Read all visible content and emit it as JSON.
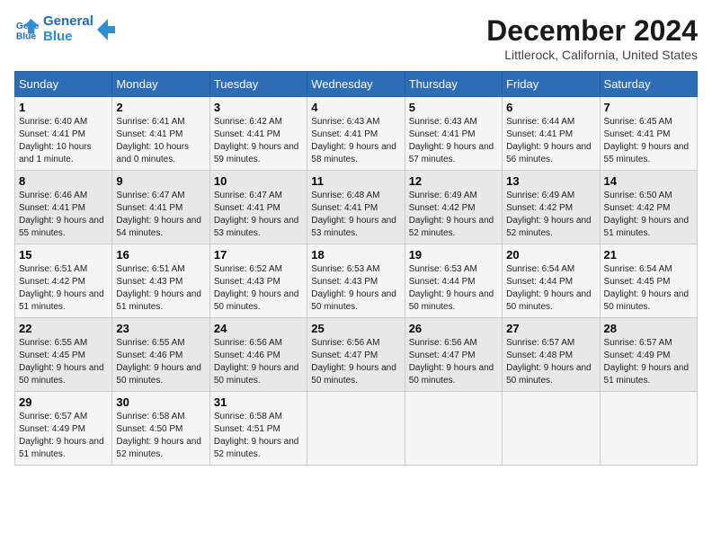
{
  "header": {
    "logo_line1": "General",
    "logo_line2": "Blue",
    "month_title": "December 2024",
    "location": "Littlerock, California, United States"
  },
  "days_of_week": [
    "Sunday",
    "Monday",
    "Tuesday",
    "Wednesday",
    "Thursday",
    "Friday",
    "Saturday"
  ],
  "weeks": [
    [
      {
        "day": "1",
        "sunrise": "6:40 AM",
        "sunset": "4:41 PM",
        "daylight": "10 hours and 1 minute."
      },
      {
        "day": "2",
        "sunrise": "6:41 AM",
        "sunset": "4:41 PM",
        "daylight": "10 hours and 0 minutes."
      },
      {
        "day": "3",
        "sunrise": "6:42 AM",
        "sunset": "4:41 PM",
        "daylight": "9 hours and 59 minutes."
      },
      {
        "day": "4",
        "sunrise": "6:43 AM",
        "sunset": "4:41 PM",
        "daylight": "9 hours and 58 minutes."
      },
      {
        "day": "5",
        "sunrise": "6:43 AM",
        "sunset": "4:41 PM",
        "daylight": "9 hours and 57 minutes."
      },
      {
        "day": "6",
        "sunrise": "6:44 AM",
        "sunset": "4:41 PM",
        "daylight": "9 hours and 56 minutes."
      },
      {
        "day": "7",
        "sunrise": "6:45 AM",
        "sunset": "4:41 PM",
        "daylight": "9 hours and 55 minutes."
      }
    ],
    [
      {
        "day": "8",
        "sunrise": "6:46 AM",
        "sunset": "4:41 PM",
        "daylight": "9 hours and 55 minutes."
      },
      {
        "day": "9",
        "sunrise": "6:47 AM",
        "sunset": "4:41 PM",
        "daylight": "9 hours and 54 minutes."
      },
      {
        "day": "10",
        "sunrise": "6:47 AM",
        "sunset": "4:41 PM",
        "daylight": "9 hours and 53 minutes."
      },
      {
        "day": "11",
        "sunrise": "6:48 AM",
        "sunset": "4:41 PM",
        "daylight": "9 hours and 53 minutes."
      },
      {
        "day": "12",
        "sunrise": "6:49 AM",
        "sunset": "4:42 PM",
        "daylight": "9 hours and 52 minutes."
      },
      {
        "day": "13",
        "sunrise": "6:49 AM",
        "sunset": "4:42 PM",
        "daylight": "9 hours and 52 minutes."
      },
      {
        "day": "14",
        "sunrise": "6:50 AM",
        "sunset": "4:42 PM",
        "daylight": "9 hours and 51 minutes."
      }
    ],
    [
      {
        "day": "15",
        "sunrise": "6:51 AM",
        "sunset": "4:42 PM",
        "daylight": "9 hours and 51 minutes."
      },
      {
        "day": "16",
        "sunrise": "6:51 AM",
        "sunset": "4:43 PM",
        "daylight": "9 hours and 51 minutes."
      },
      {
        "day": "17",
        "sunrise": "6:52 AM",
        "sunset": "4:43 PM",
        "daylight": "9 hours and 50 minutes."
      },
      {
        "day": "18",
        "sunrise": "6:53 AM",
        "sunset": "4:43 PM",
        "daylight": "9 hours and 50 minutes."
      },
      {
        "day": "19",
        "sunrise": "6:53 AM",
        "sunset": "4:44 PM",
        "daylight": "9 hours and 50 minutes."
      },
      {
        "day": "20",
        "sunrise": "6:54 AM",
        "sunset": "4:44 PM",
        "daylight": "9 hours and 50 minutes."
      },
      {
        "day": "21",
        "sunrise": "6:54 AM",
        "sunset": "4:45 PM",
        "daylight": "9 hours and 50 minutes."
      }
    ],
    [
      {
        "day": "22",
        "sunrise": "6:55 AM",
        "sunset": "4:45 PM",
        "daylight": "9 hours and 50 minutes."
      },
      {
        "day": "23",
        "sunrise": "6:55 AM",
        "sunset": "4:46 PM",
        "daylight": "9 hours and 50 minutes."
      },
      {
        "day": "24",
        "sunrise": "6:56 AM",
        "sunset": "4:46 PM",
        "daylight": "9 hours and 50 minutes."
      },
      {
        "day": "25",
        "sunrise": "6:56 AM",
        "sunset": "4:47 PM",
        "daylight": "9 hours and 50 minutes."
      },
      {
        "day": "26",
        "sunrise": "6:56 AM",
        "sunset": "4:47 PM",
        "daylight": "9 hours and 50 minutes."
      },
      {
        "day": "27",
        "sunrise": "6:57 AM",
        "sunset": "4:48 PM",
        "daylight": "9 hours and 50 minutes."
      },
      {
        "day": "28",
        "sunrise": "6:57 AM",
        "sunset": "4:49 PM",
        "daylight": "9 hours and 51 minutes."
      }
    ],
    [
      {
        "day": "29",
        "sunrise": "6:57 AM",
        "sunset": "4:49 PM",
        "daylight": "9 hours and 51 minutes."
      },
      {
        "day": "30",
        "sunrise": "6:58 AM",
        "sunset": "4:50 PM",
        "daylight": "9 hours and 52 minutes."
      },
      {
        "day": "31",
        "sunrise": "6:58 AM",
        "sunset": "4:51 PM",
        "daylight": "9 hours and 52 minutes."
      },
      {
        "day": "",
        "sunrise": "",
        "sunset": "",
        "daylight": ""
      },
      {
        "day": "",
        "sunrise": "",
        "sunset": "",
        "daylight": ""
      },
      {
        "day": "",
        "sunrise": "",
        "sunset": "",
        "daylight": ""
      },
      {
        "day": "",
        "sunrise": "",
        "sunset": "",
        "daylight": ""
      }
    ]
  ],
  "labels": {
    "sunrise_prefix": "Sunrise: ",
    "sunset_prefix": "Sunset: ",
    "daylight_prefix": "Daylight: "
  }
}
